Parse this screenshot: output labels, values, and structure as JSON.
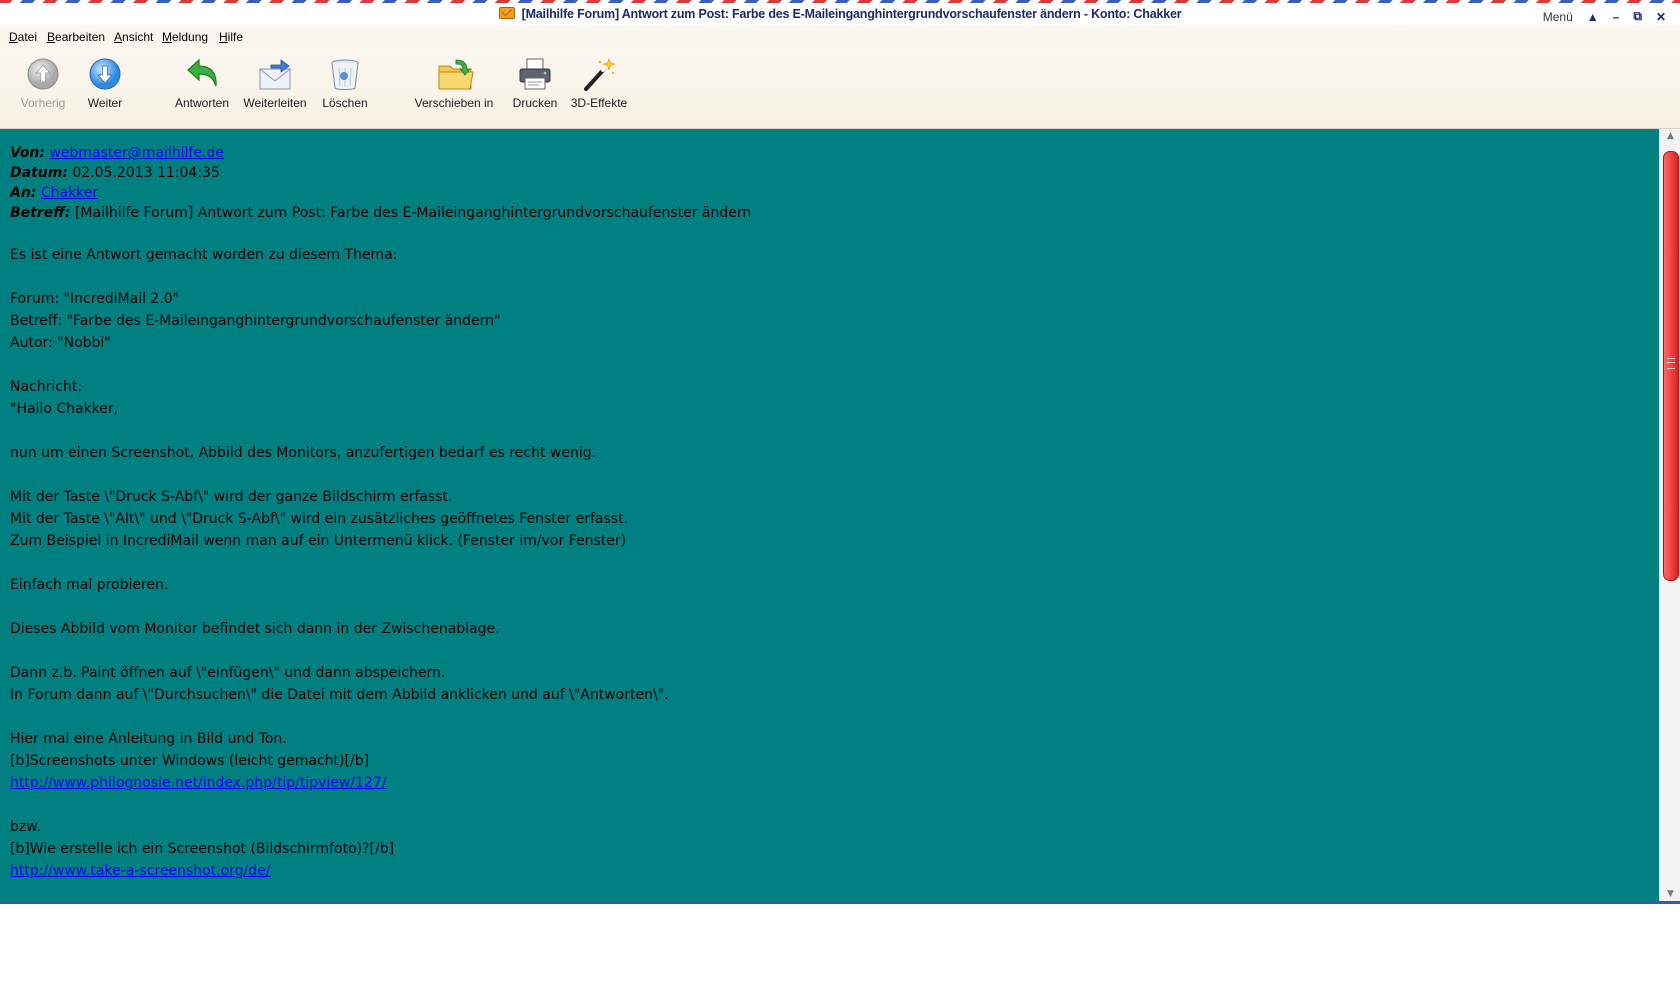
{
  "window": {
    "title": "[Mailhilfe Forum] Antwort zum Post: Farbe des E-Maileinganghintergrundvorschaufenster ändern - Konto: Chakker",
    "menu_label": "Menü",
    "up_glyph": "▲",
    "minimize_glyph": "–",
    "restore_glyph": "⧉",
    "close_glyph": "✕"
  },
  "menubar": [
    "Datei",
    "Bearbeiten",
    "Ansicht",
    "Meldung",
    "Hilfe"
  ],
  "toolbar": {
    "prev": "Vorherig",
    "next": "Weiter",
    "reply": "Antworten",
    "forward": "Weiterleiten",
    "delete": "Löschen",
    "move": "Verschieben in",
    "print": "Drucken",
    "effects": "3D-Effekte"
  },
  "header": {
    "from_label": "Von:",
    "from_value": "webmaster@mailhilfe.de",
    "date_label": "Datum:",
    "date_value": "02.05.2013 11:04:35",
    "to_label": "An:",
    "to_value": "Chakker",
    "subject_label": "Betreff:",
    "subject_value": "[Mailhilfe Forum] Antwort zum Post: Farbe des E-Maileinganghintergrundvorschaufenster ändern"
  },
  "body": {
    "l1": "Es ist eine Antwort gemacht worden zu diesem Thema:",
    "l2": "Forum: \"IncrediMail 2.0\"",
    "l3": "Betreff: \"Farbe des E-Maileinganghintergrundvorschaufenster ändern\"",
    "l4": "Autor: \"Nobbi\"",
    "l5": "Nachricht:",
    "l6": "\"Hallo Chakker,",
    "l7": "nun um einen Screenshot, Abbild des Monitors, anzufertigen bedarf es recht wenig.",
    "l8": "Mit der Taste \\\"Druck S-Abf\\\" wird der ganze Bildschirm erfasst.",
    "l9": "Mit der Taste \\\"Alt\\\" und \\\"Druck S-Abf\\\" wird ein zusätzliches geöffnetes Fenster erfasst.",
    "l10": "Zum Beispiel in IncrediMail wenn man auf ein Untermenü klick. (Fenster im/vor Fenster)",
    "l11": "Einfach mal probieren.",
    "l12": "Dieses Abbild vom Monitor befindet sich dann in der Zwischenablage.",
    "l13": "Dann z.b. Paint öffnen auf \\\"einfügen\\\" und dann abspeichern.",
    "l14": "In Forum dann auf \\\"Durchsuchen\\\" die Datei mit dem Abbild anklicken und auf \\\"Antworten\\\".",
    "l15": "Hier mal eine Anleitung in Bild und Ton.",
    "l16": "[b]Screenshots unter Windows (leicht gemacht)[/b]",
    "link1": "http://www.philognosie.net/index.php/tip/tipview/127/",
    "l17": "bzw.",
    "l18": "[b]Wie erstelle ich ein Screenshot (Bildschirmfoto)?[/b]",
    "link2": "http://www.take-a-screenshot.org/de/"
  },
  "colors": {
    "message_background": "#008080",
    "link": "#0000ff",
    "scrollbar_thumb": "#e11e1e"
  }
}
